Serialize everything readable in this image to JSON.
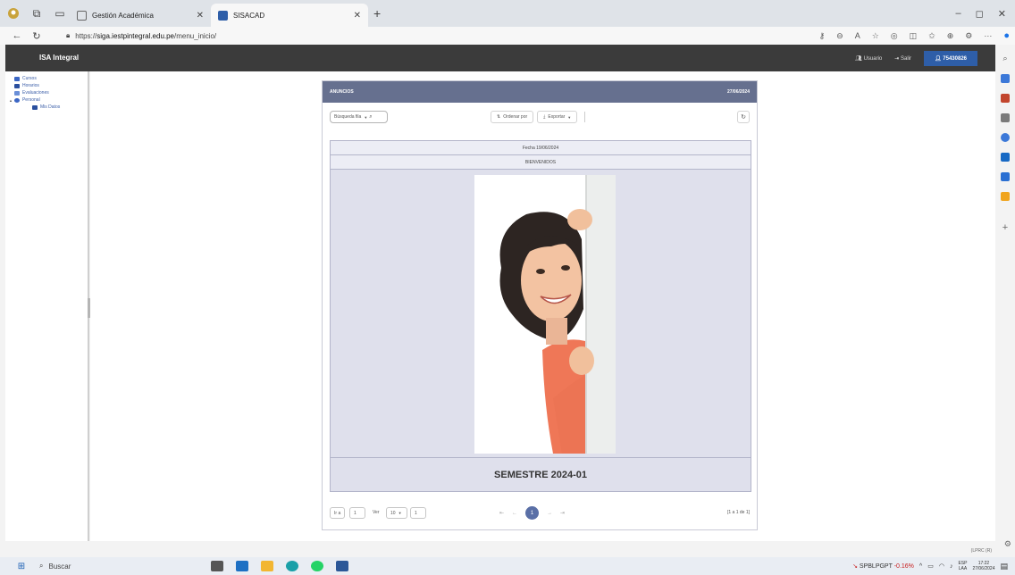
{
  "browser": {
    "tabs": [
      {
        "title": "Gestión Académica",
        "active": false
      },
      {
        "title": "SISACAD",
        "active": true
      }
    ],
    "new_tab": "+",
    "window_controls": {
      "minimize": "–",
      "restore": "◻",
      "close": "✕"
    },
    "url_prefix": "https://",
    "url_host": "siga.iestpintegral.edu.pe",
    "url_path": "/menu_inicio/"
  },
  "app": {
    "brand": "ISA Integral",
    "header": {
      "usuario": "Usuario",
      "salir": "Salir",
      "user_id": "75430826"
    }
  },
  "sidebar": {
    "items": [
      {
        "label": "Cursos",
        "color": "#3b66c4"
      },
      {
        "label": "Horarios",
        "color": "#3b66c4"
      },
      {
        "label": "Evaluaciones",
        "color": "#3b66c4"
      },
      {
        "label": "Personal",
        "color": "#3b66c4"
      },
      {
        "label": "Mis Datos",
        "color": "#3b66c4"
      }
    ]
  },
  "panel": {
    "title": "ANUNCIOS",
    "date": "27/06/2024",
    "search_placeholder": "Búsqueda fila",
    "ordenar": "Ordenar por",
    "exportar": "Exportar",
    "fecha_row": "Fecha 19/06/2024",
    "bienvenidos": "BIENVENIDOS",
    "semestre": "SEMESTRE 2024-01"
  },
  "pager": {
    "ir_a": "Ir a",
    "ir_value": "1",
    "ver": "Ver",
    "ver_value": "10",
    "ver_page": "1",
    "current": "1",
    "info": "[1 a 1 de 1]"
  },
  "footer": {
    "code": "(LPRC (R)"
  },
  "taskbar": {
    "search": "Buscar",
    "stock_name": "SPBLPGPT",
    "stock_change": "-0.16%",
    "lang_top": "ESP",
    "lang_bottom": "LAA",
    "time": "17:22",
    "date": "27/06/2024"
  },
  "colors": {
    "panel_header": "#66708f",
    "app_header": "#3b3b3b",
    "user_badge": "#2e5ea8",
    "grid_bg": "#dfe0ec"
  }
}
